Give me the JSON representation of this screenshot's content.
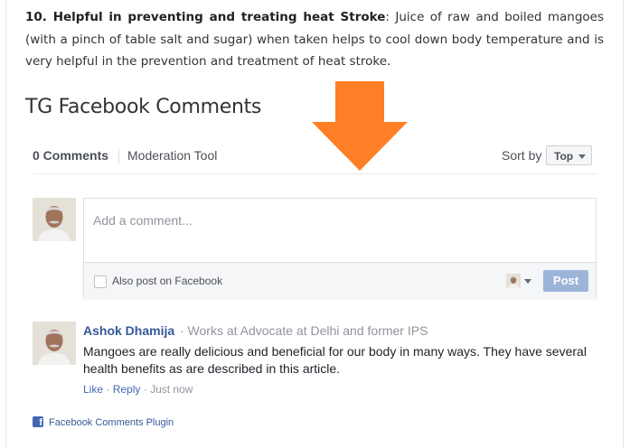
{
  "article": {
    "heading": "10. Helpful in preventing and treating heat Stroke",
    "text": "Juice of raw and boiled mangoes (with  a pinch of table salt and sugar) when  taken helps to cool down body temperature and is very helpful in  the prevention and  treatment of heat stroke."
  },
  "section_title": "TG Facebook Comments",
  "plugin": {
    "comment_count": "0 Comments",
    "moderation_tool": "Moderation Tool",
    "sort_label": "Sort by",
    "sort_value": "Top",
    "composer": {
      "placeholder": "Add a comment...",
      "also_post": "Also post on Facebook",
      "post_button": "Post"
    },
    "comment": {
      "author": "Ashok Dhamija",
      "meta": "· Works at Advocate at Delhi and former IPS",
      "text": "Mangoes are really delicious and beneficial for our body in many ways. They have several health benefits as are described in this article.",
      "like": "Like",
      "reply": "Reply",
      "time": "Just now"
    },
    "footer": "Facebook Comments Plugin"
  },
  "colors": {
    "arrow": "#ff7f27",
    "link": "#365899",
    "post_button": "#9cb4d8"
  },
  "icons": [
    "arrow-down-icon",
    "facebook-icon",
    "chevron-down-icon",
    "avatar"
  ]
}
